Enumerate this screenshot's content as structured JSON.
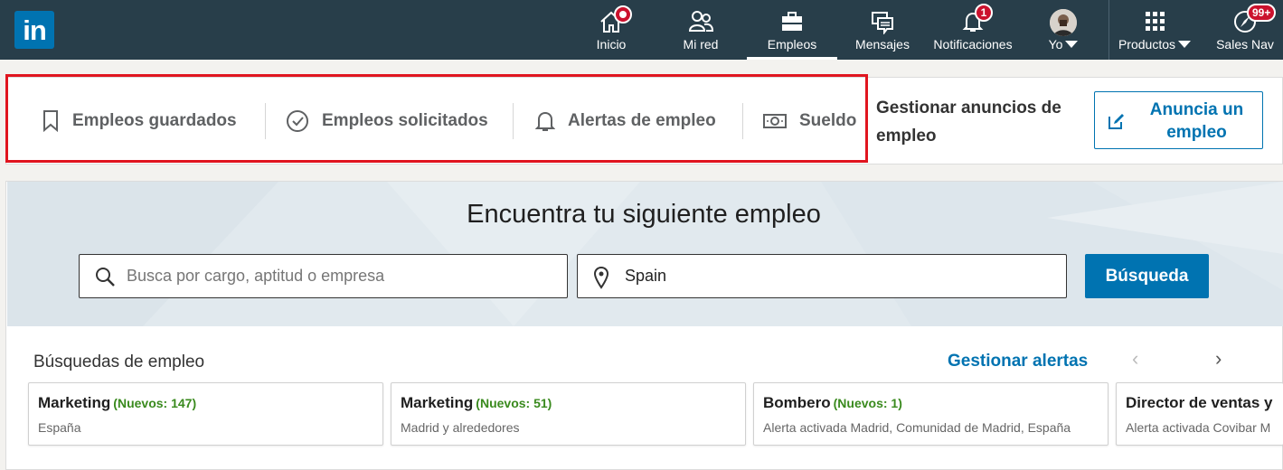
{
  "nav": {
    "logo": "in",
    "items": [
      {
        "label": "Inicio"
      },
      {
        "label": "Mi red"
      },
      {
        "label": "Empleos"
      },
      {
        "label": "Mensajes"
      },
      {
        "label": "Notificaciones",
        "badge": "1"
      },
      {
        "label": "Yo"
      },
      {
        "label": "Productos"
      },
      {
        "label": "Sales Nav",
        "badge": "99+"
      }
    ]
  },
  "jobbar": {
    "links": [
      {
        "label": "Empleos guardados",
        "icon": "bookmark-icon"
      },
      {
        "label": "Empleos solicitados",
        "icon": "check-circle-icon"
      },
      {
        "label": "Alertas de empleo",
        "icon": "bell-icon"
      },
      {
        "label": "Sueldo",
        "icon": "money-icon"
      }
    ],
    "manage_postings": "Gestionar anuncios de empleo",
    "post_job_button": "Anuncia un empleo"
  },
  "search": {
    "title": "Encuentra tu siguiente empleo",
    "keyword_placeholder": "Busca por cargo, aptitud o empresa",
    "keyword_value": "",
    "location_value": "Spain",
    "button": "Búsqueda"
  },
  "saved_searches": {
    "title": "Búsquedas de empleo",
    "manage_link": "Gestionar alertas",
    "prev": "‹",
    "next": "›",
    "cards": [
      {
        "title": "Marketing",
        "new": "(Nuevos: 147)",
        "sub": "España"
      },
      {
        "title": "Marketing",
        "new": "(Nuevos: 51)",
        "sub": "Madrid y alrededores"
      },
      {
        "title": "Bombero",
        "new": "(Nuevos: 1)",
        "sub": "Alerta activada Madrid, Comunidad de Madrid, España"
      },
      {
        "title": "Director de ventas y",
        "new": "",
        "sub": "Alerta activada Covibar M"
      }
    ]
  },
  "colors": {
    "nav_bg": "#283e4a",
    "brand_blue": "#0073b1",
    "highlight_red": "#e0151f",
    "badge_red": "#cb112d",
    "new_green": "#3a8a1e"
  }
}
